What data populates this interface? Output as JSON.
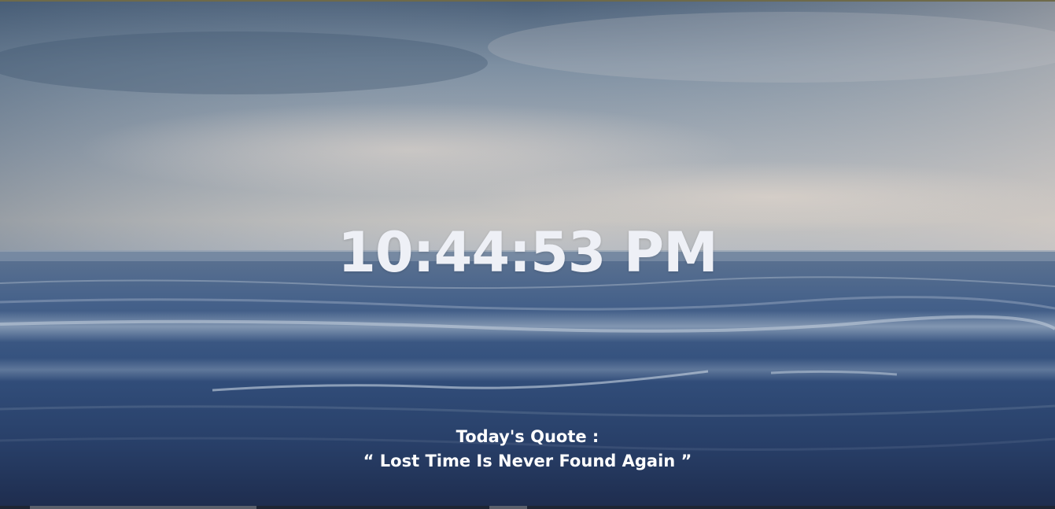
{
  "clock": {
    "time": "10:44:53 PM"
  },
  "quote": {
    "title": "Today's Quote :",
    "text": "“ Lost Time Is Never Found Again ”"
  },
  "colors": {
    "sky_top": "#4a6078",
    "sky_mid": "#93a3b2",
    "horizon": "#c8c4bf",
    "sea_top": "#4d6585",
    "sea_bottom": "#1f2c4e",
    "text": "#eef0f6"
  }
}
